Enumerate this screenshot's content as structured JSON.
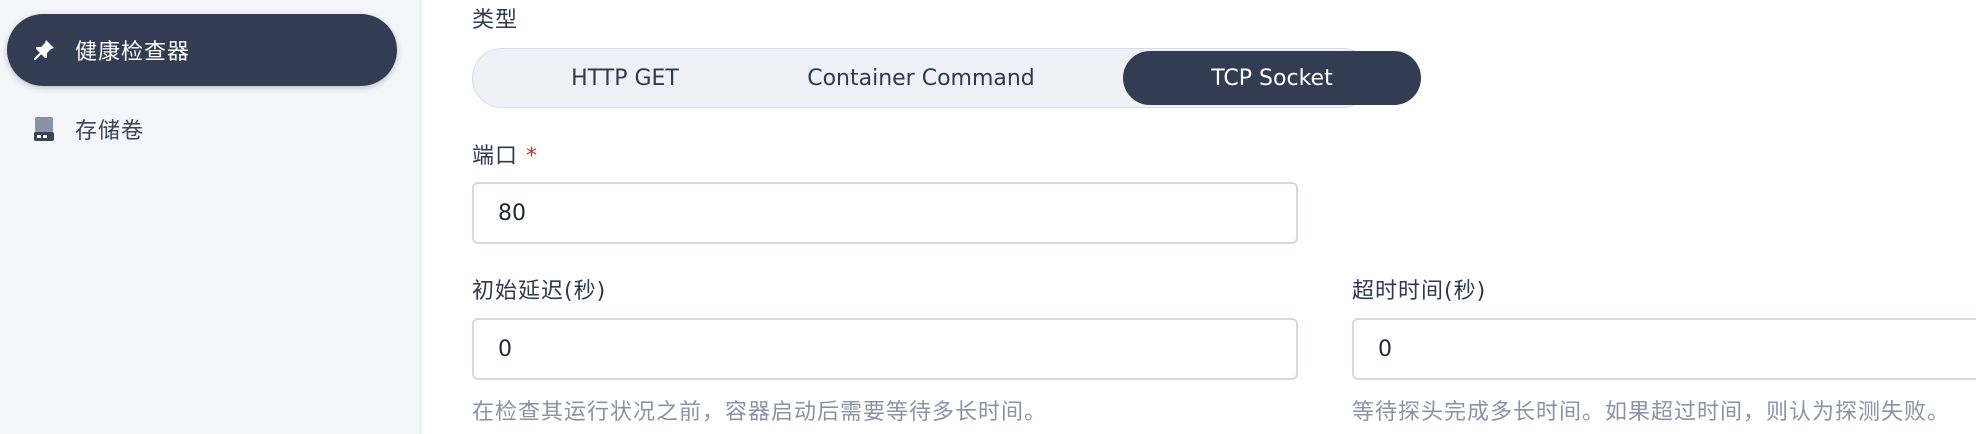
{
  "sidebar": {
    "items": [
      {
        "label": "健康检查器",
        "icon": "pin-icon",
        "active": true
      },
      {
        "label": "存储卷",
        "icon": "storage-icon",
        "active": false
      }
    ]
  },
  "form": {
    "type": {
      "label": "类型",
      "options": [
        "HTTP GET",
        "Container Command",
        "TCP Socket"
      ],
      "selected": "TCP Socket"
    },
    "port": {
      "label": "端口",
      "required_mark": "*",
      "value": "80"
    },
    "initial_delay": {
      "label": "初始延迟(秒)",
      "value": "0",
      "help": "在检查其运行状况之前，容器启动后需要等待多长时间。"
    },
    "timeout": {
      "label": "超时时间(秒)",
      "value": "0",
      "help": "等待探头完成多长时间。如果超过时间，则认为探测失败。"
    }
  },
  "colors": {
    "active_bg": "#323c52",
    "sidebar_bg": "#f4f6fa",
    "required": "#c0392b",
    "help_text": "#8a93a5"
  }
}
